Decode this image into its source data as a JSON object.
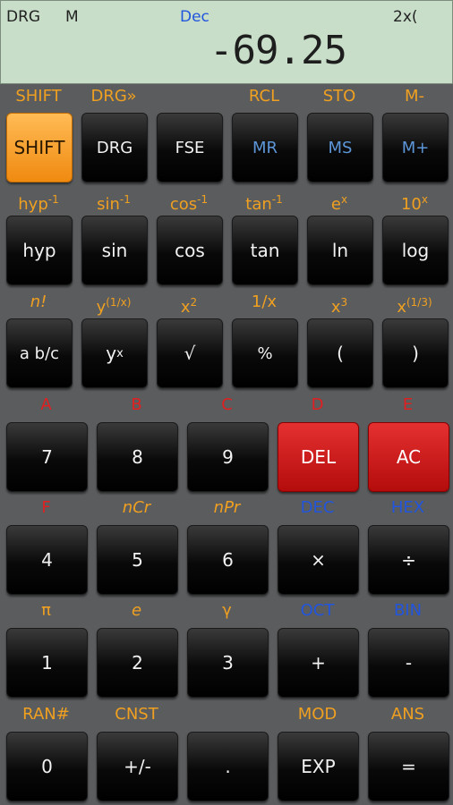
{
  "display": {
    "angle_mode": "DRG",
    "memory_flag": "M",
    "base_mode": "Dec",
    "paren_count": "2x(",
    "value": "-69.25"
  },
  "rows": [
    {
      "labels": [
        {
          "text": "SHIFT"
        },
        {
          "text": "DRG»"
        },
        {
          "text": ""
        },
        {
          "text": "RCL"
        },
        {
          "text": "STO"
        },
        {
          "text": "M-"
        }
      ],
      "keys": [
        {
          "label": "SHIFT"
        },
        {
          "label": "DRG"
        },
        {
          "label": "FSE"
        },
        {
          "label": "MR"
        },
        {
          "label": "MS"
        },
        {
          "label": "M+"
        }
      ]
    },
    {
      "labels": [
        {
          "base": "hyp",
          "sup": "-1"
        },
        {
          "base": "sin",
          "sup": "-1"
        },
        {
          "base": "cos",
          "sup": "-1"
        },
        {
          "base": "tan",
          "sup": "-1"
        },
        {
          "base": "e",
          "sup": "x"
        },
        {
          "base": "10",
          "sup": "x"
        }
      ],
      "keys": [
        {
          "label": "hyp"
        },
        {
          "label": "sin"
        },
        {
          "label": "cos"
        },
        {
          "label": "tan"
        },
        {
          "label": "ln"
        },
        {
          "label": "log"
        }
      ]
    },
    {
      "labels": [
        {
          "text": "n!"
        },
        {
          "base": "y",
          "sup": "(1/x)"
        },
        {
          "base": "x",
          "sup": "2"
        },
        {
          "text": "1/x"
        },
        {
          "base": "x",
          "sup": "3"
        },
        {
          "base": "x",
          "sup": "(1/3)"
        }
      ],
      "keys": [
        {
          "label": "a b/c"
        },
        {
          "base": "y",
          "sup": "x"
        },
        {
          "label": "√"
        },
        {
          "label": "%"
        },
        {
          "label": "("
        },
        {
          "label": ")"
        }
      ]
    },
    {
      "labels": [
        {
          "text": "A"
        },
        {
          "text": "B"
        },
        {
          "text": "C"
        },
        {
          "text": "D"
        },
        {
          "text": "E"
        }
      ],
      "keys": [
        {
          "label": "7"
        },
        {
          "label": "8"
        },
        {
          "label": "9"
        },
        {
          "label": "DEL"
        },
        {
          "label": "AC"
        }
      ]
    },
    {
      "labels": [
        {
          "text": "F"
        },
        {
          "text": "nCr"
        },
        {
          "text": "nPr"
        },
        {
          "text": "DEC"
        },
        {
          "text": "HEX"
        }
      ],
      "keys": [
        {
          "label": "4"
        },
        {
          "label": "5"
        },
        {
          "label": "6"
        },
        {
          "label": "×"
        },
        {
          "label": "÷"
        }
      ]
    },
    {
      "labels": [
        {
          "text": "π"
        },
        {
          "text": "e"
        },
        {
          "text": "γ"
        },
        {
          "text": "OCT"
        },
        {
          "text": "BIN"
        }
      ],
      "keys": [
        {
          "label": "1"
        },
        {
          "label": "2"
        },
        {
          "label": "3"
        },
        {
          "label": "+"
        },
        {
          "label": "-"
        }
      ]
    },
    {
      "labels": [
        {
          "text": "RAN#"
        },
        {
          "text": "CNST"
        },
        {
          "text": ""
        },
        {
          "text": "MOD"
        },
        {
          "text": "ANS"
        }
      ],
      "keys": [
        {
          "label": "0"
        },
        {
          "label": "+/-"
        },
        {
          "label": "."
        },
        {
          "label": "EXP"
        },
        {
          "label": "="
        }
      ]
    }
  ],
  "colors": {
    "orange_label": "#f0a020",
    "red_label": "#e02020",
    "blue_label": "#2255dd",
    "memory_key_text": "#5c96d8",
    "shift_key": "#f5a030",
    "del_ac_key": "#d42020",
    "display_bg": "#c8dec9"
  }
}
